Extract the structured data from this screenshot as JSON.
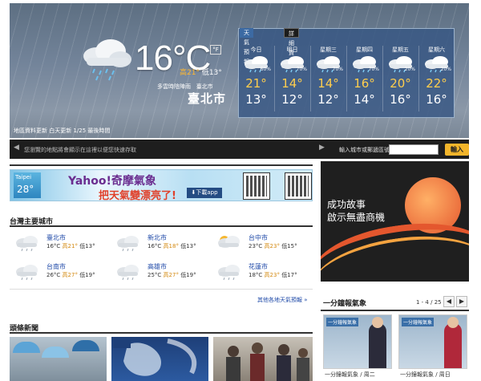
{
  "hero": {
    "temp": "16°C",
    "unit_toggle": "°F",
    "high": "高21°",
    "low": "低13°",
    "condition": "多雲時陰陣雨",
    "location_small": "臺北市",
    "city": "臺北市",
    "updated": "地區資料更新 白天更新 1/25 最後時間"
  },
  "forecast": {
    "tabs": [
      "天氣預報",
      "詳細資料"
    ],
    "days": [
      {
        "name": "今日",
        "pct": "60%",
        "high": "21°",
        "low": "13°"
      },
      {
        "name": "明日",
        "pct": "70%",
        "high": "14°",
        "low": "12°"
      },
      {
        "name": "星期三",
        "pct": "70%",
        "high": "14°",
        "low": "12°"
      },
      {
        "name": "星期四",
        "pct": "70%",
        "high": "16°",
        "low": "14°"
      },
      {
        "name": "星期五",
        "pct": "20%",
        "high": "20°",
        "low": "16°"
      },
      {
        "name": "星期六",
        "pct": "20%",
        "high": "22°",
        "low": "16°"
      }
    ]
  },
  "searchbar": {
    "message": "您瀏覽的地點將會顯示在這裡以便您快速存取",
    "zip_label": "輸入城市或郵遞區號：",
    "go": "輸入"
  },
  "banner": {
    "icon_city": "Taipei",
    "icon_temp": "28°",
    "title": "Yahoo!奇摩氣象",
    "slogan": "把天氣變漂亮了!",
    "download": "⬇下載app"
  },
  "cities_header": "台灣主要城市",
  "cities": [
    {
      "name": "臺北市",
      "temp": "16°C",
      "hi": "高21°",
      "lo": "低13°"
    },
    {
      "name": "新北市",
      "temp": "16°C",
      "hi": "高18°",
      "lo": "低13°"
    },
    {
      "name": "台中市",
      "temp": "23°C",
      "hi": "高23°",
      "lo": "低15°"
    },
    {
      "name": "台南市",
      "temp": "26°C",
      "hi": "高27°",
      "lo": "低19°"
    },
    {
      "name": "高雄市",
      "temp": "25°C",
      "hi": "高27°",
      "lo": "低19°"
    },
    {
      "name": "花蓮市",
      "temp": "18°C",
      "hi": "高23°",
      "lo": "低17°"
    }
  ],
  "more_link": "其他各地天氣預報 »",
  "ad": {
    "line1": "成功故事",
    "line2": "啟示無盡商機"
  },
  "video": {
    "header": "一分鐘報氣象",
    "pager": "1 - 4 / 25",
    "prev": "◀",
    "next": "▶",
    "items": [
      {
        "tag": "一分鐘報氣象",
        "caption": "一分鐘報氣象 / 周二"
      },
      {
        "tag": "一分鐘報氣象",
        "caption": "一分鐘報氣象 / 周日"
      }
    ]
  },
  "news_header": "頭條新聞"
}
